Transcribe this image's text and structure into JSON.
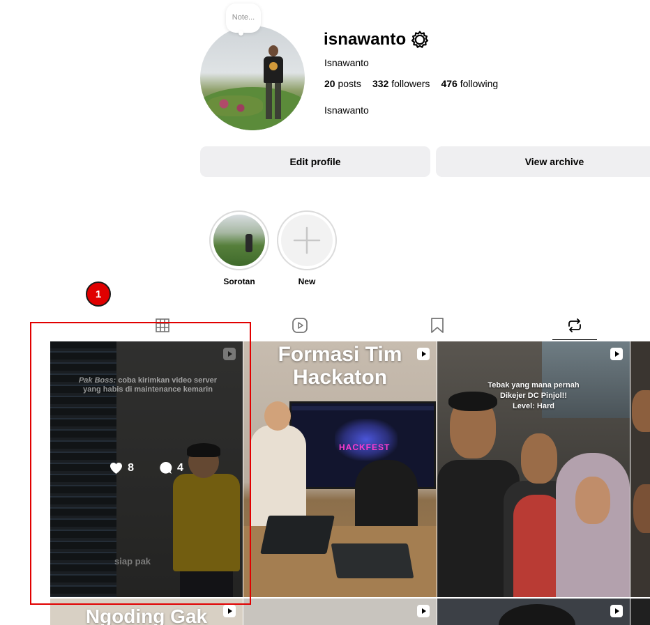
{
  "profile": {
    "note_placeholder": "Note...",
    "username": "isnawanto",
    "full_name": "Isnawanto",
    "bio": "Isnawanto",
    "stats": {
      "posts_count": "20",
      "posts_label": "posts",
      "followers_count": "332",
      "followers_label": "followers",
      "following_count": "476",
      "following_label": "following"
    },
    "settings_icon": "gear-icon"
  },
  "actions": {
    "edit_label": "Edit profile",
    "archive_label": "View archive"
  },
  "highlights": [
    {
      "label": "Sorotan"
    },
    {
      "label": "New",
      "icon": "plus-icon"
    }
  ],
  "tabs": [
    {
      "icon": "grid-icon",
      "active": false
    },
    {
      "icon": "reels-icon",
      "active": false
    },
    {
      "icon": "bookmark-icon",
      "active": false
    },
    {
      "icon": "repost-icon",
      "active": true
    }
  ],
  "grid": {
    "tile1": {
      "caption_em": "Pak Boss:",
      "caption_rest": "coba kirimkan video server yang habis di maintenance kemarin",
      "watermark": "siap pak",
      "likes": "8",
      "comments": "4"
    },
    "tile2": {
      "title": "Formasi Tim Hackaton",
      "screen_text": "HACKFEST"
    },
    "tile3": {
      "caption_line1": "Tebak yang mana pernah",
      "caption_line2": "Dikejer DC Pinjol!!",
      "caption_line3": "Level: Hard"
    },
    "tile5": {
      "title": "Ngoding Gak"
    }
  },
  "annotation": {
    "badge": "1"
  },
  "colors": {
    "button_bg": "#efeff1",
    "annotation_red": "#e10000",
    "muted_text": "#8e8e8e"
  }
}
